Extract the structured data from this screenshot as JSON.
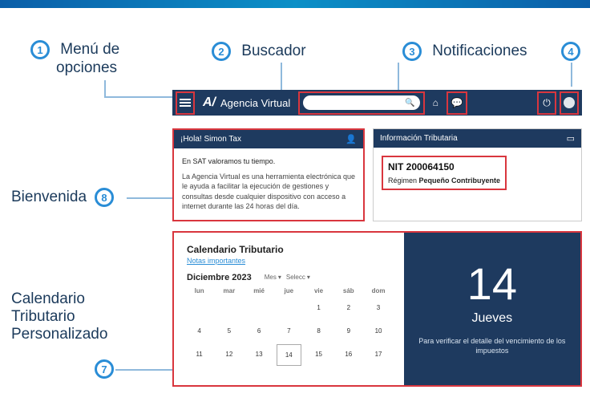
{
  "annotations": {
    "n1": "1",
    "l1a": "Menú de",
    "l1b": "opciones",
    "n2": "2",
    "l2": "Buscador",
    "n3": "3",
    "l3": "Notificaciones",
    "n4": "4",
    "n7": "7",
    "n8": "8",
    "left_bienvenida": "Bienvenida",
    "left_cal_a": "Calendario",
    "left_cal_b": "Tributario",
    "left_cal_c": "Personalizado"
  },
  "navbar": {
    "brand_mark": "A/",
    "brand_text": "Agencia Virtual",
    "search_placeholder": ""
  },
  "welcome": {
    "header": "¡Hola! Simon Tax",
    "lead": "En SAT valoramos tu tiempo.",
    "body": "La Agencia Virtual es una herramienta electrónica que le ayuda a facilitar la ejecución de gestiones y consultas desde cualquier dispositivo con acceso a internet durante las 24 horas del día."
  },
  "info": {
    "header": "Información Tributaria",
    "nit_label": "NIT 200064150",
    "regimen_prefix": "Régimen ",
    "regimen_value": "Pequeño Contribuyente"
  },
  "calendar": {
    "title": "Calendario Tributario",
    "link": "Notas importantes",
    "month": "Diciembre 2023",
    "sel1": "Mes",
    "sel2": "Selecc",
    "weekdays": [
      "lun",
      "mar",
      "mié",
      "jue",
      "vie",
      "sáb",
      "dom"
    ],
    "rows": [
      [
        "",
        "",
        "",
        "",
        "1",
        "2",
        "3"
      ],
      [
        "4",
        "5",
        "6",
        "7",
        "8",
        "9",
        "10"
      ],
      [
        "11",
        "12",
        "13",
        "14",
        "15",
        "16",
        "17"
      ]
    ],
    "selected_day": "14",
    "big_day": "14",
    "big_dayname": "Jueves",
    "note": "Para verificar el detalle del vencimiento de los impuestos"
  }
}
